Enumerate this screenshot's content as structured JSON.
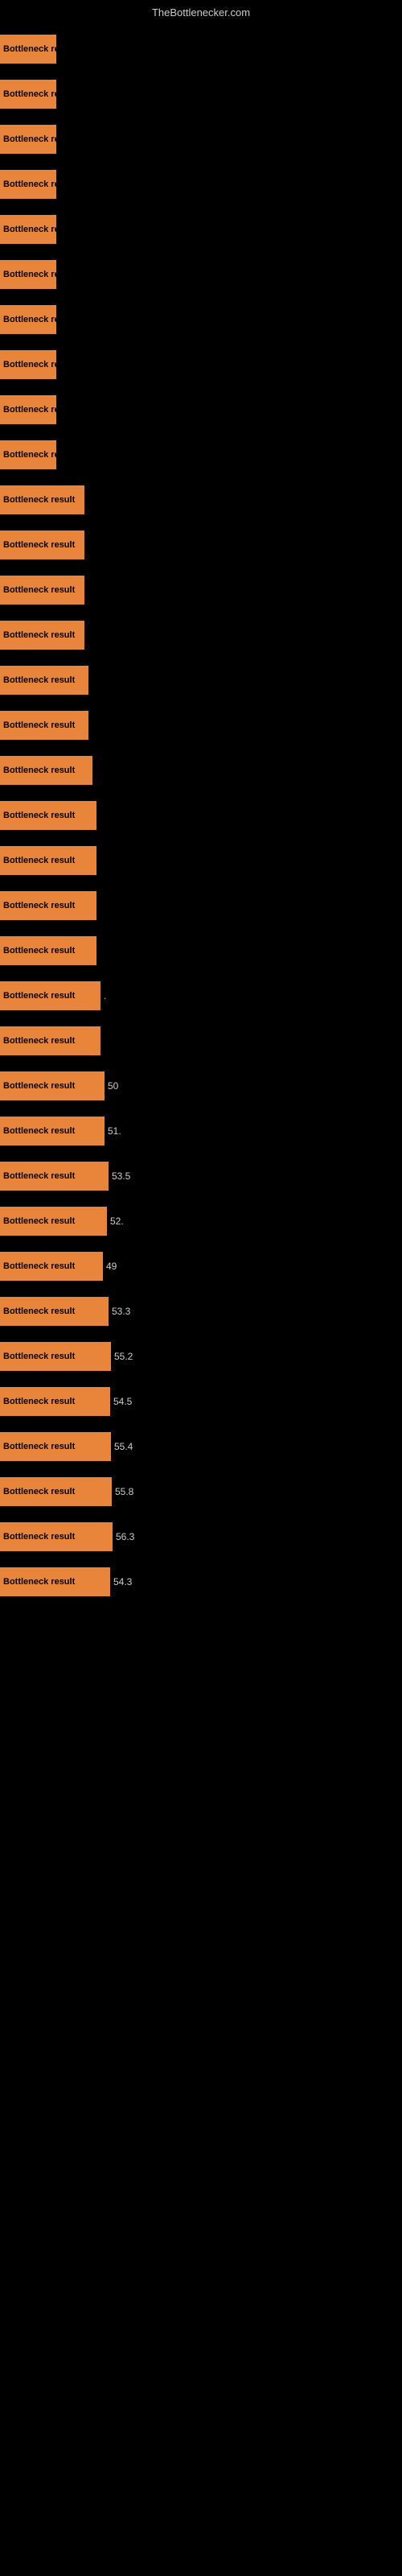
{
  "header": {
    "title": "TheBottlenecker.com"
  },
  "rows": [
    {
      "label": "Bottleneck res",
      "barWidth": 70,
      "value": ""
    },
    {
      "label": "Bottleneck res",
      "barWidth": 70,
      "value": ""
    },
    {
      "label": "Bottleneck res",
      "barWidth": 70,
      "value": ""
    },
    {
      "label": "Bottleneck res",
      "barWidth": 70,
      "value": ""
    },
    {
      "label": "Bottleneck res",
      "barWidth": 70,
      "value": ""
    },
    {
      "label": "Bottleneck res",
      "barWidth": 70,
      "value": ""
    },
    {
      "label": "Bottleneck res",
      "barWidth": 70,
      "value": ""
    },
    {
      "label": "Bottleneck res",
      "barWidth": 70,
      "value": ""
    },
    {
      "label": "Bottleneck res",
      "barWidth": 70,
      "value": ""
    },
    {
      "label": "Bottleneck res",
      "barWidth": 70,
      "value": ""
    },
    {
      "label": "Bottleneck result",
      "barWidth": 105,
      "value": ""
    },
    {
      "label": "Bottleneck result",
      "barWidth": 105,
      "value": ""
    },
    {
      "label": "Bottleneck result",
      "barWidth": 105,
      "value": ""
    },
    {
      "label": "Bottleneck result",
      "barWidth": 105,
      "value": ""
    },
    {
      "label": "Bottleneck result",
      "barWidth": 110,
      "value": ""
    },
    {
      "label": "Bottleneck result",
      "barWidth": 110,
      "value": ""
    },
    {
      "label": "Bottleneck result",
      "barWidth": 115,
      "value": ""
    },
    {
      "label": "Bottleneck result",
      "barWidth": 120,
      "value": ""
    },
    {
      "label": "Bottleneck result",
      "barWidth": 120,
      "value": ""
    },
    {
      "label": "Bottleneck result",
      "barWidth": 120,
      "value": ""
    },
    {
      "label": "Bottleneck result",
      "barWidth": 120,
      "value": ""
    },
    {
      "label": "Bottleneck result",
      "barWidth": 125,
      "value": "."
    },
    {
      "label": "Bottleneck result",
      "barWidth": 125,
      "value": ""
    },
    {
      "label": "Bottleneck result",
      "barWidth": 130,
      "value": "50"
    },
    {
      "label": "Bottleneck result",
      "barWidth": 130,
      "value": "51."
    },
    {
      "label": "Bottleneck result",
      "barWidth": 135,
      "value": "53.5"
    },
    {
      "label": "Bottleneck result",
      "barWidth": 133,
      "value": "52."
    },
    {
      "label": "Bottleneck result",
      "barWidth": 128,
      "value": "49"
    },
    {
      "label": "Bottleneck result",
      "barWidth": 135,
      "value": "53.3"
    },
    {
      "label": "Bottleneck result",
      "barWidth": 138,
      "value": "55.2"
    },
    {
      "label": "Bottleneck result",
      "barWidth": 137,
      "value": "54.5"
    },
    {
      "label": "Bottleneck result",
      "barWidth": 138,
      "value": "55.4"
    },
    {
      "label": "Bottleneck result",
      "barWidth": 139,
      "value": "55.8"
    },
    {
      "label": "Bottleneck result",
      "barWidth": 140,
      "value": "56.3"
    },
    {
      "label": "Bottleneck result",
      "barWidth": 137,
      "value": "54.3"
    }
  ]
}
